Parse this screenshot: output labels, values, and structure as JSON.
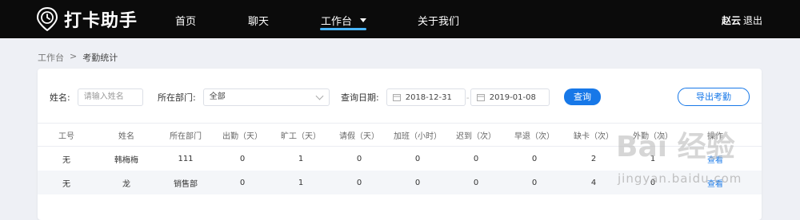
{
  "app": {
    "name": "打卡助手",
    "logo_icon": "clock-pin-icon"
  },
  "nav": {
    "items": [
      {
        "label": "首页"
      },
      {
        "label": "聊天"
      },
      {
        "label": "工作台",
        "active": true,
        "dropdown_icon": "caret-down-icon"
      },
      {
        "label": "关于我们"
      }
    ]
  },
  "user": {
    "name": "赵云",
    "logout_label": "退出"
  },
  "breadcrumb": {
    "root": "工作台",
    "separator": ">",
    "current": "考勤统计"
  },
  "filters": {
    "name_label": "姓名:",
    "name_placeholder": "请输入姓名",
    "dept_label": "所在部门:",
    "dept_value": "全部",
    "date_label": "查询日期:",
    "date_start": "2018-12-31",
    "date_sep": "-",
    "date_end": "2019-01-08",
    "query_label": "查询",
    "export_label": "导出考勤"
  },
  "table": {
    "columns": [
      "工号",
      "姓名",
      "所在部门",
      "出勤（天）",
      "旷工（天）",
      "请假（天）",
      "加班（小时）",
      "迟到（次）",
      "早退（次）",
      "缺卡（次）",
      "外勤（次）",
      "操作"
    ],
    "rows": [
      {
        "id": "无",
        "name": "韩梅梅",
        "dept": "111",
        "attend": "0",
        "absent": "1",
        "leave": "0",
        "overtime": "0",
        "late": "0",
        "early": "0",
        "missing": "2",
        "field": "1",
        "op": "查看"
      },
      {
        "id": "无",
        "name": "龙",
        "dept": "销售部",
        "attend": "0",
        "absent": "1",
        "leave": "0",
        "overtime": "0",
        "late": "0",
        "early": "0",
        "missing": "4",
        "field": "0",
        "op": "查看"
      }
    ]
  },
  "watermark": {
    "text": "Bai 经验",
    "url": "jingyan.baidu.com"
  },
  "colors": {
    "topbar": "#0b0b0b",
    "accent": "#1778e8",
    "nav_underline": "#49b6ff",
    "page_bg": "#eef0f5"
  }
}
